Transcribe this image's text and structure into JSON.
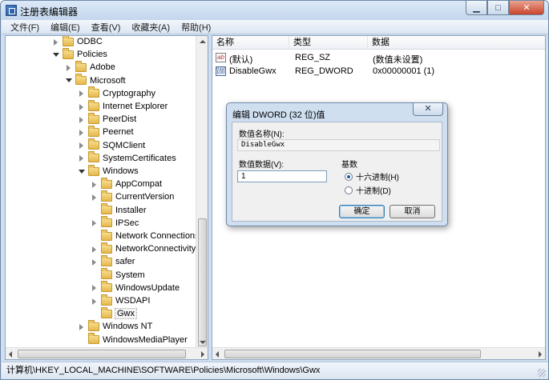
{
  "window": {
    "title": "注册表编辑器",
    "buttons": {
      "minimize": "▁",
      "maximize": "□",
      "close": "✕"
    }
  },
  "menu": [
    "文件(F)",
    "编辑(E)",
    "查看(V)",
    "收藏夹(A)",
    "帮助(H)"
  ],
  "tree": {
    "items": [
      {
        "label": "ODBC",
        "level": 1,
        "state": "closed"
      },
      {
        "label": "Policies",
        "level": 1,
        "state": "open"
      },
      {
        "label": "Adobe",
        "level": 2,
        "state": "closed"
      },
      {
        "label": "Microsoft",
        "level": 2,
        "state": "open"
      },
      {
        "label": "Cryptography",
        "level": 3,
        "state": "closed"
      },
      {
        "label": "Internet Explorer",
        "level": 3,
        "state": "closed"
      },
      {
        "label": "PeerDist",
        "level": 3,
        "state": "closed"
      },
      {
        "label": "Peernet",
        "level": 3,
        "state": "closed"
      },
      {
        "label": "SQMClient",
        "level": 3,
        "state": "closed"
      },
      {
        "label": "SystemCertificates",
        "level": 3,
        "state": "closed"
      },
      {
        "label": "Windows",
        "level": 3,
        "state": "open"
      },
      {
        "label": "AppCompat",
        "level": 4,
        "state": "closed"
      },
      {
        "label": "CurrentVersion",
        "level": 4,
        "state": "closed"
      },
      {
        "label": "Installer",
        "level": 4,
        "state": "none"
      },
      {
        "label": "IPSec",
        "level": 4,
        "state": "closed"
      },
      {
        "label": "Network Connections",
        "level": 4,
        "state": "none"
      },
      {
        "label": "NetworkConnectivitySta",
        "level": 4,
        "state": "closed"
      },
      {
        "label": "safer",
        "level": 4,
        "state": "closed"
      },
      {
        "label": "System",
        "level": 4,
        "state": "none"
      },
      {
        "label": "WindowsUpdate",
        "level": 4,
        "state": "closed"
      },
      {
        "label": "WSDAPI",
        "level": 4,
        "state": "closed"
      },
      {
        "label": "Gwx",
        "level": 4,
        "state": "none",
        "selected": true
      },
      {
        "label": "Windows NT",
        "level": 3,
        "state": "closed"
      },
      {
        "label": "WindowsMediaPlayer",
        "level": 3,
        "state": "none"
      }
    ]
  },
  "list": {
    "headers": {
      "name": "名称",
      "type": "类型",
      "data": "数据"
    },
    "rows": [
      {
        "icon": "string-value-icon",
        "name": "(默认)",
        "type": "REG_SZ",
        "data": "(数值未设置)"
      },
      {
        "icon": "binary-value-icon",
        "name": "DisableGwx",
        "type": "REG_DWORD",
        "data": "0x00000001 (1)"
      }
    ]
  },
  "dialog": {
    "title": "编辑 DWORD (32 位)值",
    "close": "✕",
    "name_label": "数值名称(N):",
    "name_value": "DisableGwx",
    "data_label": "数值数据(V):",
    "data_value": "1",
    "base_label": "基数",
    "radio_hex": "十六进制(H)",
    "radio_dec": "十进制(D)",
    "hex_selected": true,
    "ok": "确定",
    "cancel": "取消"
  },
  "status": "计算机\\HKEY_LOCAL_MACHINE\\SOFTWARE\\Policies\\Microsoft\\Windows\\Gwx"
}
